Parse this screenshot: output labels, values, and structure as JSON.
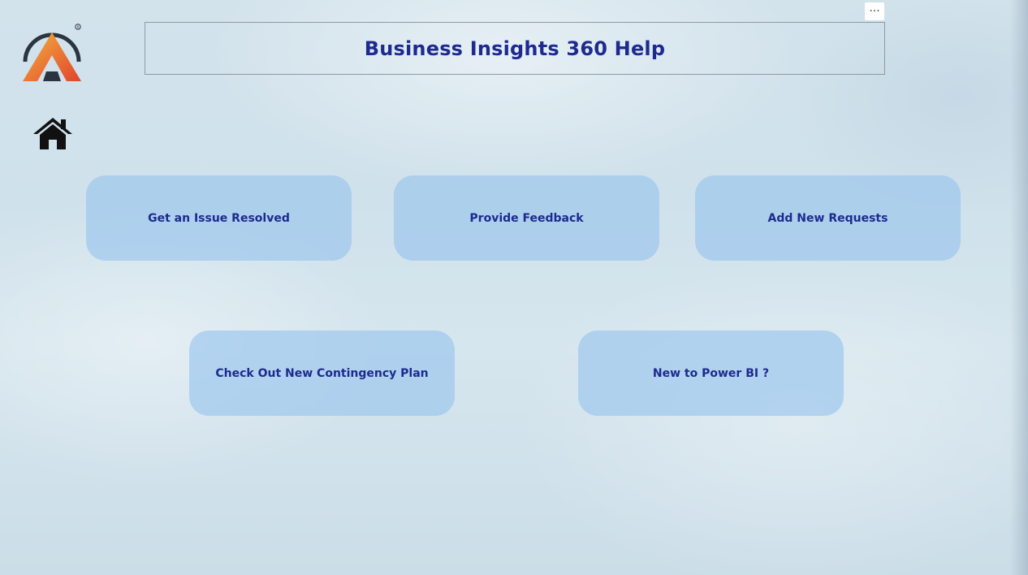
{
  "header": {
    "title": "Business Insights 360 Help",
    "more_options_icon": "ellipsis-icon",
    "more_options_label": "···"
  },
  "logo": {
    "icon": "atliq-logo-icon",
    "colors": [
      "#2b3540",
      "#f0a53a",
      "#e0442e"
    ]
  },
  "navigation": {
    "home_icon": "home-icon"
  },
  "buttons": [
    {
      "label": "Get an Issue Resolved"
    },
    {
      "label": "Provide Feedback"
    },
    {
      "label": "Add New Requests"
    },
    {
      "label": "Check Out New Contingency Plan"
    },
    {
      "label": "New to Power BI ?"
    }
  ],
  "colors": {
    "title_text": "#1d2a8f",
    "button_fill": "#96c4ee",
    "background": "#d3e3ec"
  }
}
